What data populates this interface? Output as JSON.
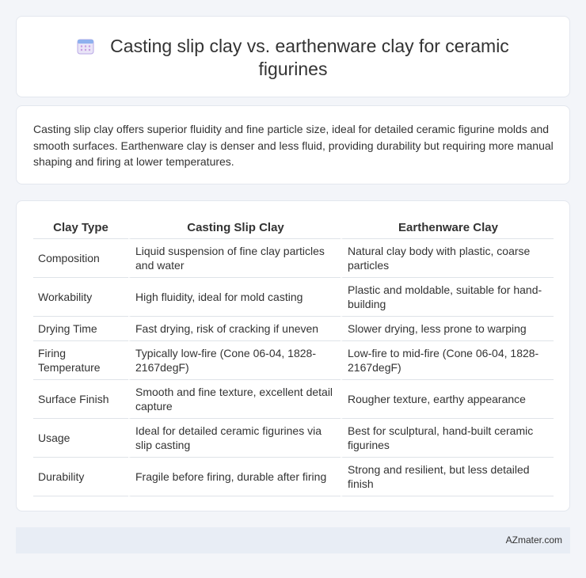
{
  "header": {
    "title": "Casting slip clay vs. earthenware clay for ceramic figurines",
    "icon": "calendar-icon"
  },
  "summary": {
    "text": "Casting slip clay offers superior fluidity and fine particle size, ideal for detailed ceramic figurine molds and smooth surfaces. Earthenware clay is denser and less fluid, providing durability but requiring more manual shaping and firing at lower temperatures."
  },
  "table": {
    "headers": [
      "Clay Type",
      "Casting Slip Clay",
      "Earthenware Clay"
    ],
    "rows": [
      [
        "Composition",
        "Liquid suspension of fine clay particles and water",
        "Natural clay body with plastic, coarse particles"
      ],
      [
        "Workability",
        "High fluidity, ideal for mold casting",
        "Plastic and moldable, suitable for hand-building"
      ],
      [
        "Drying Time",
        "Fast drying, risk of cracking if uneven",
        "Slower drying, less prone to warping"
      ],
      [
        "Firing Temperature",
        "Typically low-fire (Cone 06-04, 1828-2167degF)",
        "Low-fire to mid-fire (Cone 06-04, 1828-2167degF)"
      ],
      [
        "Surface Finish",
        "Smooth and fine texture, excellent detail capture",
        "Rougher texture, earthy appearance"
      ],
      [
        "Usage",
        "Ideal for detailed ceramic figurines via slip casting",
        "Best for sculptural, hand-built ceramic figurines"
      ],
      [
        "Durability",
        "Fragile before firing, durable after firing",
        "Strong and resilient, but less detailed finish"
      ]
    ]
  },
  "footer": {
    "brand": "AZmater.com"
  },
  "colors": {
    "background": "#f3f5f9",
    "card": "#ffffff",
    "footer": "#e8edf5"
  }
}
